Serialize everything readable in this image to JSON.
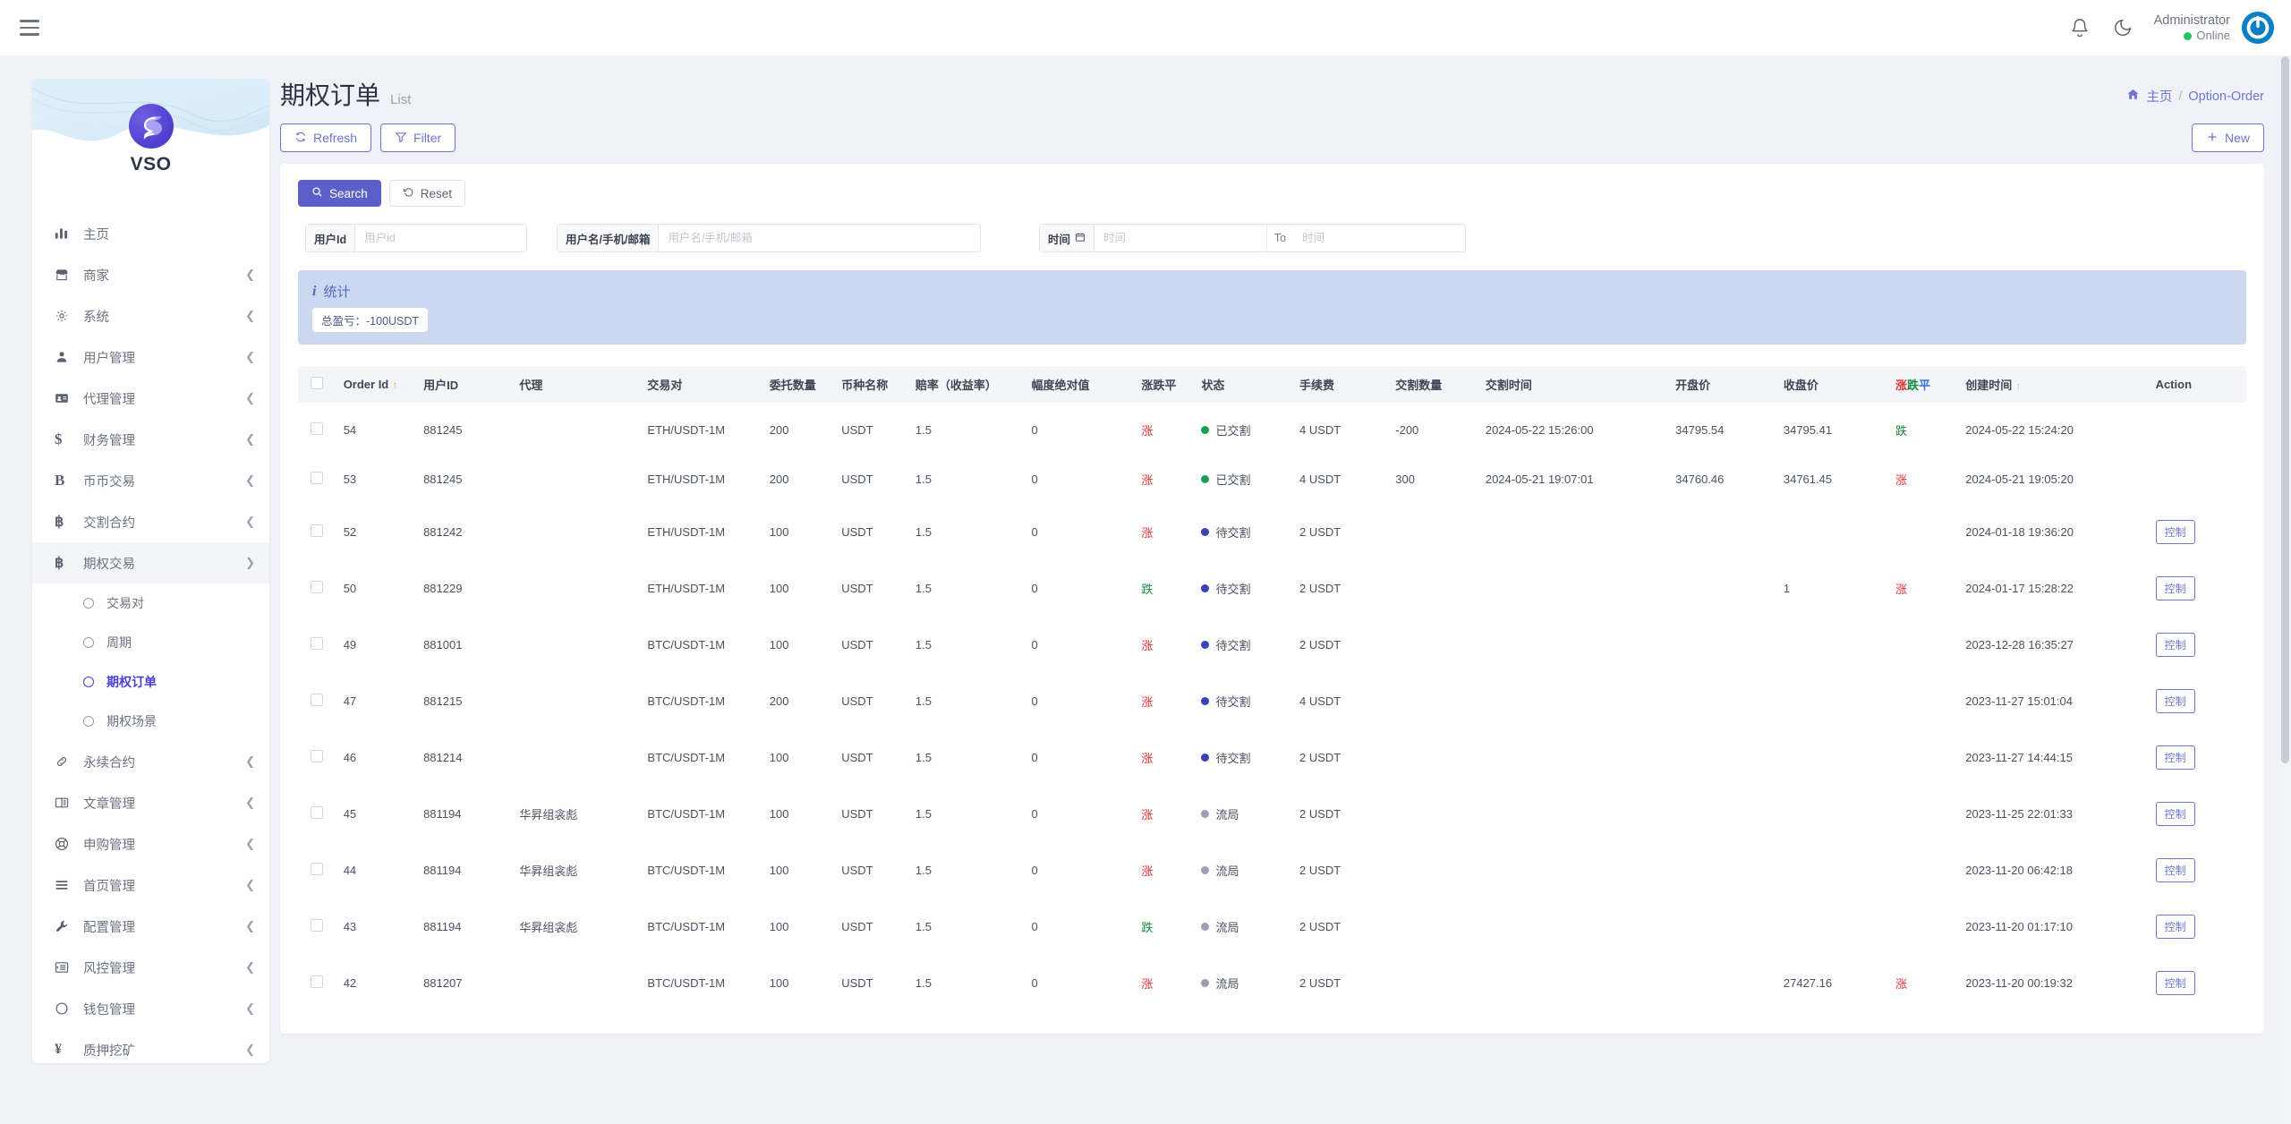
{
  "topbar": {
    "menu_icon": "hamburger-icon",
    "bell_icon": "bell-icon",
    "moon_icon": "moon-icon",
    "user_name": "Administrator",
    "user_status": "Online",
    "status_color": "#22c55e"
  },
  "sidebar": {
    "brand": "VSO",
    "items": [
      {
        "label": "主页",
        "icon": "bar-chart-icon",
        "has_children": false
      },
      {
        "label": "商家",
        "icon": "store-icon",
        "has_children": true
      },
      {
        "label": "系统",
        "icon": "gear-icon",
        "has_children": true
      },
      {
        "label": "用户管理",
        "icon": "user-icon",
        "has_children": true
      },
      {
        "label": "代理管理",
        "icon": "id-card-icon",
        "has_children": true
      },
      {
        "label": "财务管理",
        "icon": "dollar-icon",
        "has_children": true
      },
      {
        "label": "币币交易",
        "icon": "letter-b-icon",
        "has_children": true
      },
      {
        "label": "交割合约",
        "icon": "bitcoin-icon",
        "has_children": true
      },
      {
        "label": "期权交易",
        "icon": "bitcoin-icon",
        "has_children": true,
        "open": true
      },
      {
        "label": "永续合约",
        "icon": "link-icon",
        "has_children": true
      },
      {
        "label": "文章管理",
        "icon": "book-icon",
        "has_children": true
      },
      {
        "label": "申购管理",
        "icon": "lifebuoy-icon",
        "has_children": true
      },
      {
        "label": "首页管理",
        "icon": "list-icon",
        "has_children": true
      },
      {
        "label": "配置管理",
        "icon": "wrench-icon",
        "has_children": true
      },
      {
        "label": "风控管理",
        "icon": "indent-icon",
        "has_children": true
      },
      {
        "label": "钱包管理",
        "icon": "circle-icon",
        "has_children": true
      },
      {
        "label": "质押挖矿",
        "icon": "yen-icon",
        "has_children": true
      }
    ],
    "submenu": [
      {
        "label": "交易对",
        "active": false
      },
      {
        "label": "周期",
        "active": false
      },
      {
        "label": "期权订单",
        "active": true
      },
      {
        "label": "期权场景",
        "active": false
      }
    ]
  },
  "header": {
    "title": "期权订单",
    "subtitle": "List",
    "breadcrumb_home": "主页",
    "breadcrumb_current": "Option-Order",
    "breadcrumb_sep": "/"
  },
  "toolbar": {
    "refresh_label": "Refresh",
    "filter_label": "Filter",
    "new_label": "New",
    "refresh_icon": "refresh-icon",
    "filter_icon": "funnel-icon",
    "new_icon": "plus-icon"
  },
  "search": {
    "search_label": "Search",
    "reset_label": "Reset",
    "search_icon": "magnifier-icon",
    "reset_icon": "undo-icon",
    "fields": {
      "userid_label": "用户Id",
      "userid_placeholder": "用户id",
      "userid_value": "",
      "username_label": "用户名/手机/邮箱",
      "username_placeholder": "用户名/手机/邮箱",
      "username_value": "",
      "time_label": "时间",
      "time_icon": "calendar-icon",
      "time_from_placeholder": "时间",
      "time_from_value": "",
      "time_to_text": "To",
      "time_to_placeholder": "时间",
      "time_to_value": ""
    }
  },
  "stats": {
    "icon": "info-icon",
    "title": "统计",
    "chips": [
      "总盈亏：-100USDT"
    ]
  },
  "table": {
    "columns": [
      "Order Id",
      "用户ID",
      "代理",
      "交易对",
      "委托数量",
      "币种名称",
      "赔率（收益率）",
      "幅度绝对值",
      "涨跌平",
      "状态",
      "手续费",
      "交割数量",
      "交割时间",
      "开盘价",
      "收盘价",
      "涨跌平",
      "创建时间",
      "Action"
    ],
    "sort_cols": {
      "order_id": "↑",
      "create_time": "↑"
    },
    "action_label": "控制",
    "colors": {
      "up": "#e03131",
      "down": "#128a3d",
      "flat": "#3b6fd4"
    },
    "rows": [
      {
        "order_id": "54",
        "user_id": "881245",
        "agent": "",
        "pair": "ETH/USDT-1M",
        "amount": "200",
        "coin": "USDT",
        "rate": "1.5",
        "abs": "0",
        "ud": "涨",
        "ud_dir": "up",
        "status": "已交割",
        "status_kind": "done",
        "fee": "4 USDT",
        "settle_qty": "-200",
        "settle_time": "2024-05-22 15:26:00",
        "open": "34795.54",
        "close": "34795.41",
        "ud2": "跌",
        "ud2_dir": "down",
        "create_time": "2024-05-22 15:24:20",
        "action": ""
      },
      {
        "order_id": "53",
        "user_id": "881245",
        "agent": "",
        "pair": "ETH/USDT-1M",
        "amount": "200",
        "coin": "USDT",
        "rate": "1.5",
        "abs": "0",
        "ud": "涨",
        "ud_dir": "up",
        "status": "已交割",
        "status_kind": "done",
        "fee": "4 USDT",
        "settle_qty": "300",
        "settle_time": "2024-05-21 19:07:01",
        "open": "34760.46",
        "close": "34761.45",
        "ud2": "涨",
        "ud2_dir": "up",
        "create_time": "2024-05-21 19:05:20",
        "action": ""
      },
      {
        "order_id": "52",
        "user_id": "881242",
        "agent": "",
        "pair": "ETH/USDT-1M",
        "amount": "100",
        "coin": "USDT",
        "rate": "1.5",
        "abs": "0",
        "ud": "涨",
        "ud_dir": "up",
        "status": "待交割",
        "status_kind": "pend",
        "fee": "2 USDT",
        "settle_qty": "",
        "settle_time": "",
        "open": "",
        "close": "",
        "ud2": "",
        "ud2_dir": "",
        "create_time": "2024-01-18 19:36:20",
        "action": "控制"
      },
      {
        "order_id": "50",
        "user_id": "881229",
        "agent": "",
        "pair": "ETH/USDT-1M",
        "amount": "100",
        "coin": "USDT",
        "rate": "1.5",
        "abs": "0",
        "ud": "跌",
        "ud_dir": "down",
        "status": "待交割",
        "status_kind": "pend",
        "fee": "2 USDT",
        "settle_qty": "",
        "settle_time": "",
        "open": "",
        "close": "1",
        "ud2": "涨",
        "ud2_dir": "up",
        "create_time": "2024-01-17 15:28:22",
        "action": "控制"
      },
      {
        "order_id": "49",
        "user_id": "881001",
        "agent": "",
        "pair": "BTC/USDT-1M",
        "amount": "100",
        "coin": "USDT",
        "rate": "1.5",
        "abs": "0",
        "ud": "涨",
        "ud_dir": "up",
        "status": "待交割",
        "status_kind": "pend",
        "fee": "2 USDT",
        "settle_qty": "",
        "settle_time": "",
        "open": "",
        "close": "",
        "ud2": "",
        "ud2_dir": "",
        "create_time": "2023-12-28 16:35:27",
        "action": "控制"
      },
      {
        "order_id": "47",
        "user_id": "881215",
        "agent": "",
        "pair": "BTC/USDT-1M",
        "amount": "200",
        "coin": "USDT",
        "rate": "1.5",
        "abs": "0",
        "ud": "涨",
        "ud_dir": "up",
        "status": "待交割",
        "status_kind": "pend",
        "fee": "4 USDT",
        "settle_qty": "",
        "settle_time": "",
        "open": "",
        "close": "",
        "ud2": "",
        "ud2_dir": "",
        "create_time": "2023-11-27 15:01:04",
        "action": "控制"
      },
      {
        "order_id": "46",
        "user_id": "881214",
        "agent": "",
        "pair": "BTC/USDT-1M",
        "amount": "100",
        "coin": "USDT",
        "rate": "1.5",
        "abs": "0",
        "ud": "涨",
        "ud_dir": "up",
        "status": "待交割",
        "status_kind": "pend",
        "fee": "2 USDT",
        "settle_qty": "",
        "settle_time": "",
        "open": "",
        "close": "",
        "ud2": "",
        "ud2_dir": "",
        "create_time": "2023-11-27 14:44:15",
        "action": "控制"
      },
      {
        "order_id": "45",
        "user_id": "881194",
        "agent": "华昇组衾彪",
        "pair": "BTC/USDT-1M",
        "amount": "100",
        "coin": "USDT",
        "rate": "1.5",
        "abs": "0",
        "ud": "涨",
        "ud_dir": "up",
        "status": "流局",
        "status_kind": "void",
        "fee": "2 USDT",
        "settle_qty": "",
        "settle_time": "",
        "open": "",
        "close": "",
        "ud2": "",
        "ud2_dir": "",
        "create_time": "2023-11-25 22:01:33",
        "action": "控制"
      },
      {
        "order_id": "44",
        "user_id": "881194",
        "agent": "华昇组衾彪",
        "pair": "BTC/USDT-1M",
        "amount": "100",
        "coin": "USDT",
        "rate": "1.5",
        "abs": "0",
        "ud": "涨",
        "ud_dir": "up",
        "status": "流局",
        "status_kind": "void",
        "fee": "2 USDT",
        "settle_qty": "",
        "settle_time": "",
        "open": "",
        "close": "",
        "ud2": "",
        "ud2_dir": "",
        "create_time": "2023-11-20 06:42:18",
        "action": "控制"
      },
      {
        "order_id": "43",
        "user_id": "881194",
        "agent": "华昇组衾彪",
        "pair": "BTC/USDT-1M",
        "amount": "100",
        "coin": "USDT",
        "rate": "1.5",
        "abs": "0",
        "ud": "跌",
        "ud_dir": "down",
        "status": "流局",
        "status_kind": "void",
        "fee": "2 USDT",
        "settle_qty": "",
        "settle_time": "",
        "open": "",
        "close": "",
        "ud2": "",
        "ud2_dir": "",
        "create_time": "2023-11-20 01:17:10",
        "action": "控制"
      },
      {
        "order_id": "42",
        "user_id": "881207",
        "agent": "",
        "pair": "BTC/USDT-1M",
        "amount": "100",
        "coin": "USDT",
        "rate": "1.5",
        "abs": "0",
        "ud": "涨",
        "ud_dir": "up",
        "status": "流局",
        "status_kind": "void",
        "fee": "2 USDT",
        "settle_qty": "",
        "settle_time": "",
        "open": "",
        "close": "27427.16",
        "ud2": "涨",
        "ud2_dir": "up",
        "create_time": "2023-11-20 00:19:32",
        "action": "控制"
      }
    ]
  }
}
